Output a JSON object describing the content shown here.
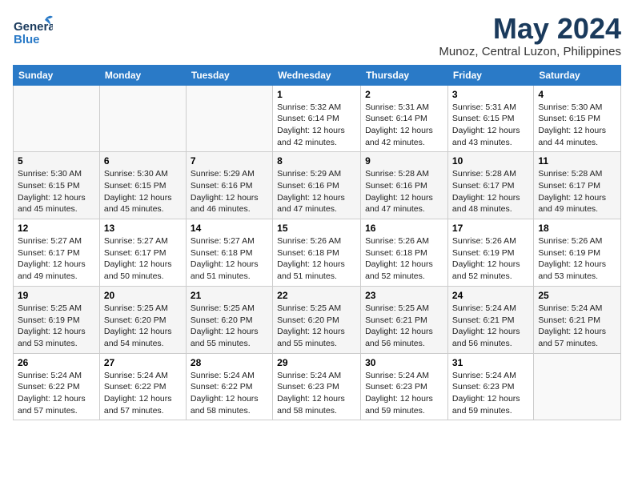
{
  "header": {
    "logo_general": "General",
    "logo_blue": "Blue",
    "month_year": "May 2024",
    "location": "Munoz, Central Luzon, Philippines"
  },
  "days_of_week": [
    "Sunday",
    "Monday",
    "Tuesday",
    "Wednesday",
    "Thursday",
    "Friday",
    "Saturday"
  ],
  "weeks": [
    [
      {
        "day": "",
        "info": ""
      },
      {
        "day": "",
        "info": ""
      },
      {
        "day": "",
        "info": ""
      },
      {
        "day": "1",
        "info": "Sunrise: 5:32 AM\nSunset: 6:14 PM\nDaylight: 12 hours\nand 42 minutes."
      },
      {
        "day": "2",
        "info": "Sunrise: 5:31 AM\nSunset: 6:14 PM\nDaylight: 12 hours\nand 42 minutes."
      },
      {
        "day": "3",
        "info": "Sunrise: 5:31 AM\nSunset: 6:15 PM\nDaylight: 12 hours\nand 43 minutes."
      },
      {
        "day": "4",
        "info": "Sunrise: 5:30 AM\nSunset: 6:15 PM\nDaylight: 12 hours\nand 44 minutes."
      }
    ],
    [
      {
        "day": "5",
        "info": "Sunrise: 5:30 AM\nSunset: 6:15 PM\nDaylight: 12 hours\nand 45 minutes."
      },
      {
        "day": "6",
        "info": "Sunrise: 5:30 AM\nSunset: 6:15 PM\nDaylight: 12 hours\nand 45 minutes."
      },
      {
        "day": "7",
        "info": "Sunrise: 5:29 AM\nSunset: 6:16 PM\nDaylight: 12 hours\nand 46 minutes."
      },
      {
        "day": "8",
        "info": "Sunrise: 5:29 AM\nSunset: 6:16 PM\nDaylight: 12 hours\nand 47 minutes."
      },
      {
        "day": "9",
        "info": "Sunrise: 5:28 AM\nSunset: 6:16 PM\nDaylight: 12 hours\nand 47 minutes."
      },
      {
        "day": "10",
        "info": "Sunrise: 5:28 AM\nSunset: 6:17 PM\nDaylight: 12 hours\nand 48 minutes."
      },
      {
        "day": "11",
        "info": "Sunrise: 5:28 AM\nSunset: 6:17 PM\nDaylight: 12 hours\nand 49 minutes."
      }
    ],
    [
      {
        "day": "12",
        "info": "Sunrise: 5:27 AM\nSunset: 6:17 PM\nDaylight: 12 hours\nand 49 minutes."
      },
      {
        "day": "13",
        "info": "Sunrise: 5:27 AM\nSunset: 6:17 PM\nDaylight: 12 hours\nand 50 minutes."
      },
      {
        "day": "14",
        "info": "Sunrise: 5:27 AM\nSunset: 6:18 PM\nDaylight: 12 hours\nand 51 minutes."
      },
      {
        "day": "15",
        "info": "Sunrise: 5:26 AM\nSunset: 6:18 PM\nDaylight: 12 hours\nand 51 minutes."
      },
      {
        "day": "16",
        "info": "Sunrise: 5:26 AM\nSunset: 6:18 PM\nDaylight: 12 hours\nand 52 minutes."
      },
      {
        "day": "17",
        "info": "Sunrise: 5:26 AM\nSunset: 6:19 PM\nDaylight: 12 hours\nand 52 minutes."
      },
      {
        "day": "18",
        "info": "Sunrise: 5:26 AM\nSunset: 6:19 PM\nDaylight: 12 hours\nand 53 minutes."
      }
    ],
    [
      {
        "day": "19",
        "info": "Sunrise: 5:25 AM\nSunset: 6:19 PM\nDaylight: 12 hours\nand 53 minutes."
      },
      {
        "day": "20",
        "info": "Sunrise: 5:25 AM\nSunset: 6:20 PM\nDaylight: 12 hours\nand 54 minutes."
      },
      {
        "day": "21",
        "info": "Sunrise: 5:25 AM\nSunset: 6:20 PM\nDaylight: 12 hours\nand 55 minutes."
      },
      {
        "day": "22",
        "info": "Sunrise: 5:25 AM\nSunset: 6:20 PM\nDaylight: 12 hours\nand 55 minutes."
      },
      {
        "day": "23",
        "info": "Sunrise: 5:25 AM\nSunset: 6:21 PM\nDaylight: 12 hours\nand 56 minutes."
      },
      {
        "day": "24",
        "info": "Sunrise: 5:24 AM\nSunset: 6:21 PM\nDaylight: 12 hours\nand 56 minutes."
      },
      {
        "day": "25",
        "info": "Sunrise: 5:24 AM\nSunset: 6:21 PM\nDaylight: 12 hours\nand 57 minutes."
      }
    ],
    [
      {
        "day": "26",
        "info": "Sunrise: 5:24 AM\nSunset: 6:22 PM\nDaylight: 12 hours\nand 57 minutes."
      },
      {
        "day": "27",
        "info": "Sunrise: 5:24 AM\nSunset: 6:22 PM\nDaylight: 12 hours\nand 57 minutes."
      },
      {
        "day": "28",
        "info": "Sunrise: 5:24 AM\nSunset: 6:22 PM\nDaylight: 12 hours\nand 58 minutes."
      },
      {
        "day": "29",
        "info": "Sunrise: 5:24 AM\nSunset: 6:23 PM\nDaylight: 12 hours\nand 58 minutes."
      },
      {
        "day": "30",
        "info": "Sunrise: 5:24 AM\nSunset: 6:23 PM\nDaylight: 12 hours\nand 59 minutes."
      },
      {
        "day": "31",
        "info": "Sunrise: 5:24 AM\nSunset: 6:23 PM\nDaylight: 12 hours\nand 59 minutes."
      },
      {
        "day": "",
        "info": ""
      }
    ]
  ]
}
